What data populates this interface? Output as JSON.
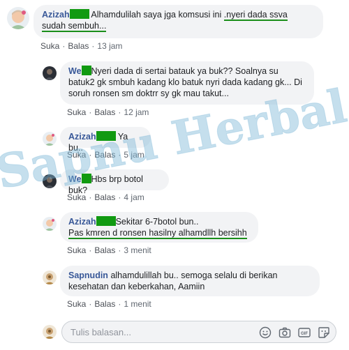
{
  "comments": [
    {
      "name": "Azizah",
      "text_a": "Alhamdulilah saya jga komsusi ini ",
      "text_b": ".nyeri dada ssva",
      "text_c": "sudah sembuh...",
      "like": "Suka",
      "reply": "Balas",
      "time": "13 jam"
    },
    {
      "name": "We",
      "text": "Nyeri dada di sertai batauk ya buk?? Soalnya su batuk2 gk smbuh kadang klo batuk nyri dada kadang gk... Di soruh ronsen sm doktrr sy gk mau takut...",
      "like": "Suka",
      "reply": "Balas",
      "time": "12 jam"
    },
    {
      "name": "Azizah",
      "text": "Ya bu..",
      "like": "Suka",
      "reply": "Balas",
      "time": "5 jam"
    },
    {
      "name": "We",
      "text": "Hbs brp botol buk?",
      "like": "Suka",
      "reply": "Balas",
      "time": "4 jam"
    },
    {
      "name": "Azizah",
      "text_a": "Sekitar 6-7botol bun..",
      "text_b": "Pas kmren d ronsen hasilny alhamdllh bersihh",
      "like": "Suka",
      "reply": "Balas",
      "time": "3 menit"
    },
    {
      "name": "Sapnudin",
      "text": "alhamdulillah bu.. semoga selalu di berikan kesehatan dan keberkahan, Aamiin",
      "like": "Suka",
      "reply": "Balas",
      "time": "1 menit"
    }
  ],
  "reply_box": {
    "placeholder": "Tulis balasan..."
  },
  "watermark": {
    "text": "Sapnu Herbal"
  },
  "icons": {
    "emoji": "smiley-icon",
    "camera": "camera-icon",
    "gif": "gif-icon",
    "sticker": "sticker-icon"
  },
  "colors": {
    "name_link": "#385898",
    "bubble_bg": "#f2f3f5",
    "redaction": "#119a11",
    "underline": "#1a8e1a",
    "watermark": "#7fb8d8"
  }
}
